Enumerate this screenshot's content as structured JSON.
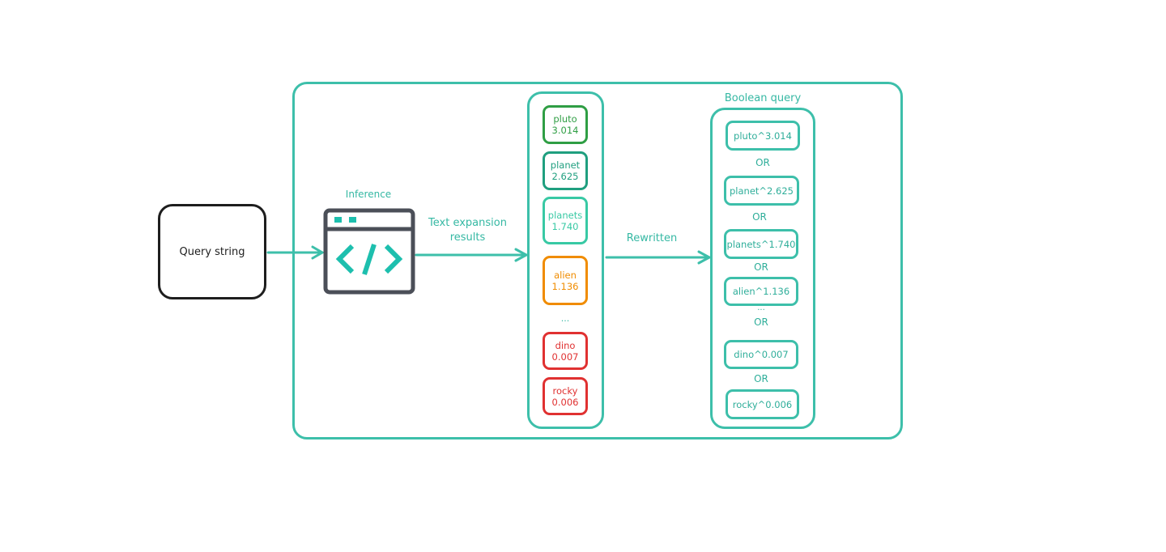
{
  "input": {
    "label": "Query string"
  },
  "inference": {
    "label": "Inference",
    "icon": "code-window-icon"
  },
  "arrows": {
    "expansion_label_line1": "Text expansion",
    "expansion_label_line2": "results",
    "rewritten_label": "Rewritten"
  },
  "expansion_results": [
    {
      "token": "pluto",
      "weight": "3.014",
      "color": "#2f9e44"
    },
    {
      "token": "planet",
      "weight": "2.625",
      "color": "#1f9f7f"
    },
    {
      "token": "planets",
      "weight": "1.740",
      "color": "#38c9a4"
    },
    {
      "token": "alien",
      "weight": "1.136",
      "color": "#f08c00"
    },
    {
      "token": "dino",
      "weight": "0.007",
      "color": "#e03131"
    },
    {
      "token": "rocky",
      "weight": "0.006",
      "color": "#e03131"
    }
  ],
  "expansion_ellipsis": "...",
  "boolean_query": {
    "title": "Boolean query",
    "clauses": [
      "pluto^3.014",
      "planet^2.625",
      "planets^1.740",
      "alien^1.136",
      "dino^0.007",
      "rocky^0.006"
    ],
    "operator": "OR",
    "ellipsis": "..."
  },
  "colors": {
    "teal": "#3dbfaa",
    "icon_gray": "#4b4f58",
    "icon_teal": "#1dbfae"
  }
}
